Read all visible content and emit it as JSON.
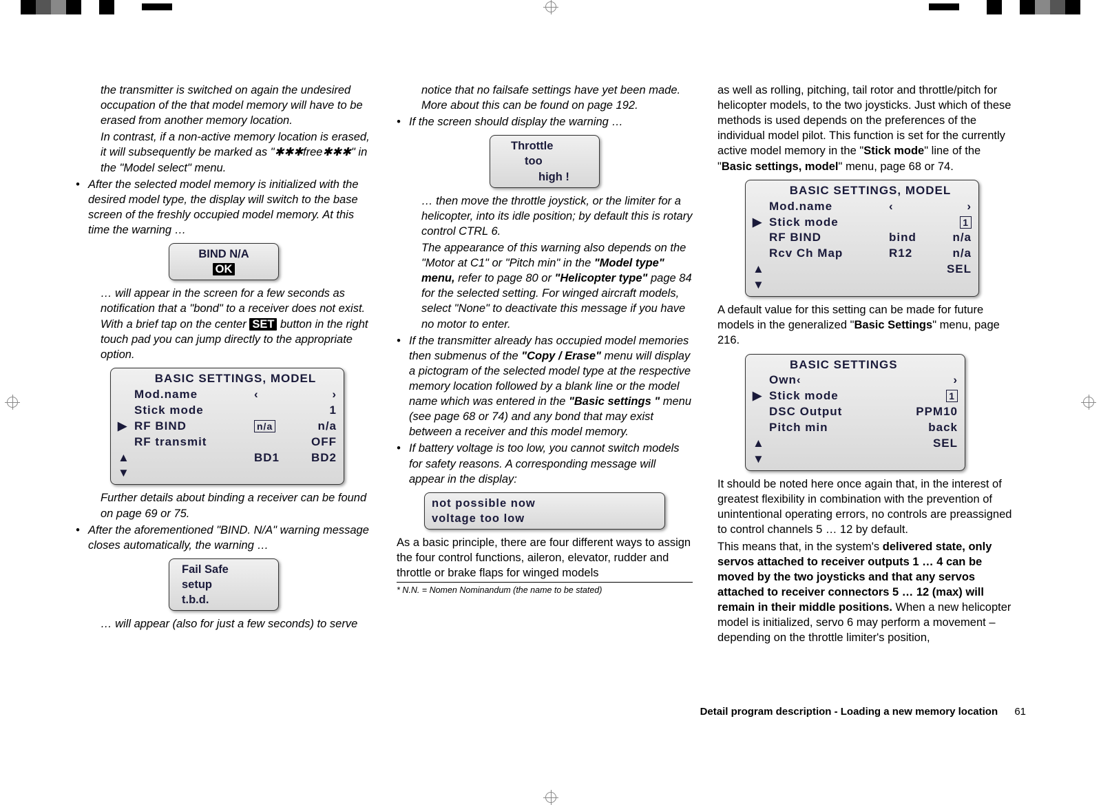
{
  "col1": {
    "p1": "the transmitter is switched on again the undesired occupation of the that model memory will have to be erased from another memory location.",
    "p2a": "In contrast, if a non-active memory location is erased, it will subsequently be marked as \"",
    "p2b": "free",
    "p2c": "\" in the \"Model select\" menu.",
    "li1": "After the selected model memory is initialized with the desired model type, the display will switch to the base screen of the freshly occupied model memory. At this time the warning …",
    "disp1_l1": "BIND N/A",
    "disp1_ok": "OK",
    "p3a": "… will appear in the screen for a few seconds as notification that a \"bond\" to a receiver does not exist. With a brief tap on the center ",
    "p3b": "SET",
    "p3c": " button in the right touch pad you can jump directly to the appropriate option.",
    "disp2_title": "BASIC  SETTINGS,  MODEL",
    "disp2_r1_c2": "Mod.name",
    "disp2_r2_c2": "Stick mode",
    "disp2_r2_c4": "1",
    "disp2_r3_c2": "RF BIND",
    "disp2_r3_c3": "n/a",
    "disp2_r3_c4": "n/a",
    "disp2_r4_c2": "RF transmit",
    "disp2_r4_c4": "OFF",
    "disp2_r5_c3": "BD1",
    "disp2_r5_c4": "BD2",
    "p4": "Further details about binding a receiver can be found on page 69 or 75.",
    "li2": "After the aforementioned \"BIND. N/A\" warning message closes automatically, the warning …",
    "disp3_l1": "Fail Safe",
    "disp3_l2": "setup",
    "disp3_l3": "t.b.d.",
    "p5": "… will appear (also for just a few seconds) to serve"
  },
  "col2": {
    "p1": "notice that no failsafe settings have yet been made. More about this can be found on page 192.",
    "li1": "If the screen should display the warning …",
    "disp1_l1": "Throttle",
    "disp1_l2": "too",
    "disp1_l3": "high !",
    "p2a": "… then move the throttle joystick, or the limiter for a helicopter, into its idle position; by default this is rotary control CTRL 6.",
    "p2b1": "The appearance of this warning also depends on the \"Motor at C1\" or \"Pitch min\" in the ",
    "p2b2": "\"Model type\" menu,",
    "p2b3": " refer to page 80 or ",
    "p2b4": "\"Helicopter type\"",
    "p2b5": " page 84 for the selected setting. For winged aircraft models, select \"None\" to deactivate this message if you have no motor to enter.",
    "li2a": "If the transmitter already has occupied model memories then submenus of the ",
    "li2b": "\"Copy / Erase\"",
    "li2c": " menu will display a pictogram of the selected model type at the respective memory location followed by a blank line or the model name which was entered in the ",
    "li2d": "\"Basic settings \"",
    "li2e": " menu (see page 68 or 74) and any bond that may exist between a receiver and this model memory.",
    "li3": "If battery voltage is too low, you cannot switch models for safety reasons. A corresponding message will appear in the display:",
    "disp2_l1": "not  possible  now",
    "disp2_l2": "voltage  too  low",
    "p3": "As a basic principle, there are four different ways to assign the four control functions, aileron, elevator, rudder and throttle or brake flaps for winged models",
    "footnote": "*    N.N. = Nomen Nominandum (the name to be stated)"
  },
  "col3": {
    "p1a": "as well as rolling, pitching, tail rotor and throttle/pitch for helicopter models, to the two joysticks. Just which of these methods is used depends on the preferences of the individual model pilot. This function is set for the currently active model memory in the \"",
    "p1b": "Stick mode",
    "p1c": "\" line of the \"",
    "p1d": "Basic settings, model",
    "p1e": "\" menu, page 68 or 74.",
    "disp1_title": "BASIC  SETTINGS,  MODEL",
    "disp1_r1_c2": "Mod.name",
    "disp1_r2_c2": "Stick mode",
    "disp1_r2_c4": "1",
    "disp1_r3_c2": "RF BIND",
    "disp1_r3_c3": "bind",
    "disp1_r3_c4": "n/a",
    "disp1_r4_c2": "Rcv Ch Map",
    "disp1_r4_c3": "R12",
    "disp1_r4_c4": "n/a",
    "disp1_r5_c4": "SEL",
    "p2a": "A default value for this setting can be made for future models in the generalized \"",
    "p2b": "Basic Settings",
    "p2c": "\" menu, page 216.",
    "disp2_title": "BASIC  SETTINGS",
    "disp2_r1_c2": "Own",
    "disp2_r2_c2": "Stick mode",
    "disp2_r2_c4": "1",
    "disp2_r3_c2": "DSC Output",
    "disp2_r3_c4": "PPM10",
    "disp2_r4_c2": "Pitch min",
    "disp2_r4_c4": "back",
    "disp2_r5_c4": "SEL",
    "p3": "It should be noted here once again that, in the interest of greatest flexibility in combination with the prevention of unintentional operating errors, no controls are preassigned to control channels 5 … 12 by default.",
    "p4a": "This means that, in the system's ",
    "p4b": "delivered state, only servos attached to receiver outputs 1 … 4 can be moved by the two joysticks and that any servos attached to receiver connectors 5 … 12 (max) will remain in their middle positions.",
    "p4c": " When a new helicopter model is initialized, servo 6 may perform a movement  – depending on the throttle limiter's position,"
  },
  "footer": {
    "text": "Detail program description - Loading a new memory location",
    "page": "61"
  }
}
